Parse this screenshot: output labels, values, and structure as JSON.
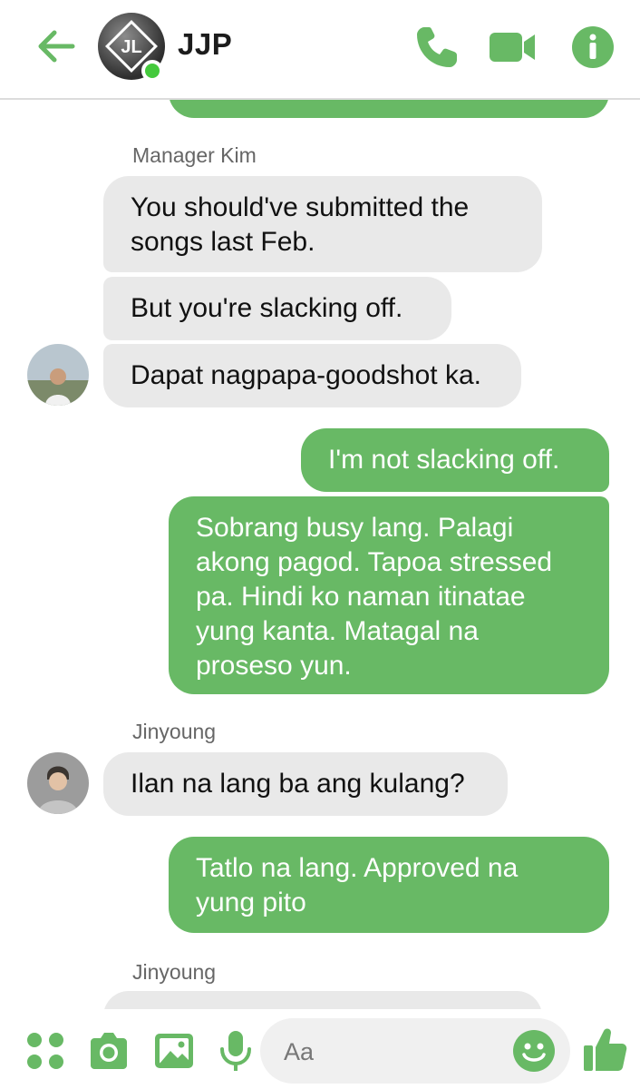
{
  "header": {
    "title": "JJP",
    "avatar_logo_text": "JL"
  },
  "colors": {
    "accent": "#68b965",
    "online": "#44c93c",
    "incoming_bubble": "#e9e9e9"
  },
  "messages": [
    {
      "sender": "Manager Kim"
    },
    {
      "text": "You should've submitted the songs last Feb."
    },
    {
      "text": "But you're slacking off."
    },
    {
      "text": "Dapat nagpapa-goodshot ka."
    },
    {
      "text": "I'm not slacking off."
    },
    {
      "text": "Sobrang busy lang. Palagi akong pagod. Tapoa stressed pa. Hindi ko naman itinatae yung kanta. Matagal na proseso yun."
    },
    {
      "sender": "Jinyoung"
    },
    {
      "text": "Ilan na lang ba ang kulang?"
    },
    {
      "text": "Tatlo na lang. Approved na yung pito"
    },
    {
      "sender": "Jinyoung"
    }
  ],
  "composer": {
    "placeholder": "Aa"
  },
  "icons": {
    "back": "arrow-left-icon",
    "call": "phone-icon",
    "video": "video-camera-icon",
    "info": "info-icon",
    "menu": "four-dots-icon",
    "camera": "camera-icon",
    "gallery": "image-icon",
    "voice": "microphone-icon",
    "emoji": "smiley-icon",
    "like": "thumbs-up-icon"
  }
}
